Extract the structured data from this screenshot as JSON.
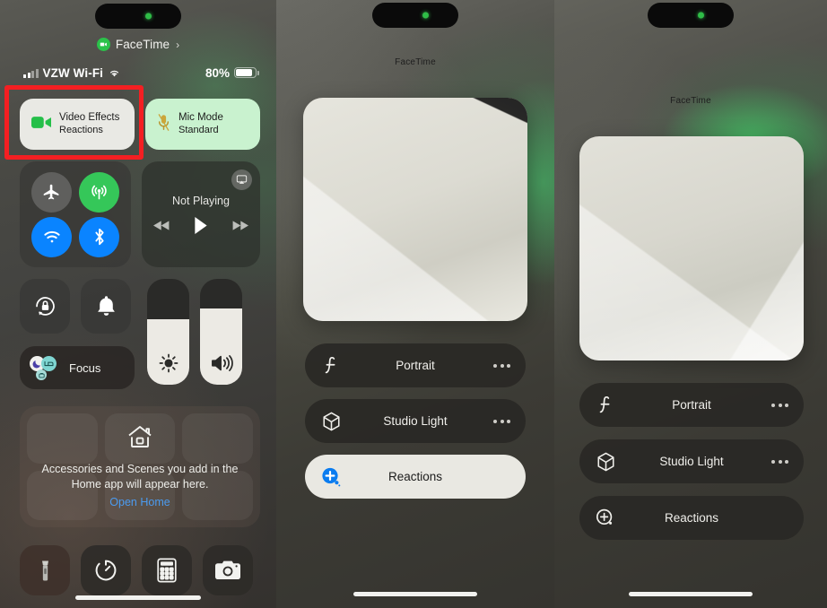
{
  "meta": {
    "accent_green": "#35c759",
    "accent_blue": "#0a84ff",
    "highlight_red": "#f41f22"
  },
  "panel1": {
    "name": "control-center",
    "facetime_pill": {
      "label": "FaceTime",
      "chevron": "›",
      "icon": "video-camera-icon"
    },
    "status_bar": {
      "carrier": "VZW Wi-Fi",
      "signal_icon": "cellular-signal-icon",
      "wifi_icon": "wifi-icon",
      "battery_percent": "80%",
      "battery_icon": "battery-icon",
      "battery_level": 78
    },
    "effects_tiles": [
      {
        "icon": "video-camera-icon",
        "title": "Video Effects",
        "subtitle": "Reactions",
        "state": "active"
      },
      {
        "icon": "mic-slash-icon",
        "title": "Mic Mode",
        "subtitle": "Standard",
        "state": "active"
      }
    ],
    "connectivity": [
      {
        "icon": "airplane-icon",
        "label": "Airplane Mode",
        "on": false
      },
      {
        "icon": "cellular-data-icon",
        "label": "Cellular Data",
        "on": true
      },
      {
        "icon": "wifi-icon",
        "label": "Wi-Fi",
        "on": true
      },
      {
        "icon": "bluetooth-icon",
        "label": "Bluetooth",
        "on": true
      }
    ],
    "media": {
      "title": "Not Playing",
      "airplay_icon": "airplay-icon",
      "controls": [
        "rewind-icon",
        "play-icon",
        "fast-forward-icon"
      ]
    },
    "toggles": [
      {
        "icon": "rotation-lock-icon",
        "label": "Rotation Lock"
      },
      {
        "icon": "bell-icon",
        "label": "Silent Mode"
      }
    ],
    "sliders": [
      {
        "icon": "brightness-icon",
        "label": "Brightness",
        "value": 62
      },
      {
        "icon": "volume-icon",
        "label": "Volume",
        "value": 72
      }
    ],
    "focus": {
      "label": "Focus",
      "icons": [
        "moon-icon",
        "bed-icon",
        "briefcase-icon"
      ]
    },
    "home_card": {
      "icon": "home-icon",
      "message": "Accessories and Scenes you add in the Home app will appear here.",
      "link": "Open Home"
    },
    "shortcuts": [
      {
        "icon": "flashlight-icon",
        "label": "Flashlight"
      },
      {
        "icon": "timer-icon",
        "label": "Timer"
      },
      {
        "icon": "calculator-icon",
        "label": "Calculator"
      },
      {
        "icon": "camera-icon",
        "label": "Camera"
      }
    ]
  },
  "panel2": {
    "name": "video-effects-menu-reactions-on",
    "app_label": "FaceTime",
    "preview_label": "camera-preview",
    "options": [
      {
        "icon": "portrait-f-icon",
        "label": "Portrait",
        "active": false,
        "has_menu": true
      },
      {
        "icon": "studio-light-cube-icon",
        "label": "Studio Light",
        "active": false,
        "has_menu": true
      },
      {
        "icon": "reactions-plus-bubble-icon",
        "label": "Reactions",
        "active": true,
        "has_menu": false
      }
    ]
  },
  "panel3": {
    "name": "video-effects-menu-reactions-off",
    "app_label": "FaceTime",
    "preview_label": "camera-preview",
    "options": [
      {
        "icon": "portrait-f-icon",
        "label": "Portrait",
        "active": false,
        "has_menu": true
      },
      {
        "icon": "studio-light-cube-icon",
        "label": "Studio Light",
        "active": false,
        "has_menu": true
      },
      {
        "icon": "reactions-plus-bubble-icon",
        "label": "Reactions",
        "active": false,
        "has_menu": false
      }
    ]
  }
}
